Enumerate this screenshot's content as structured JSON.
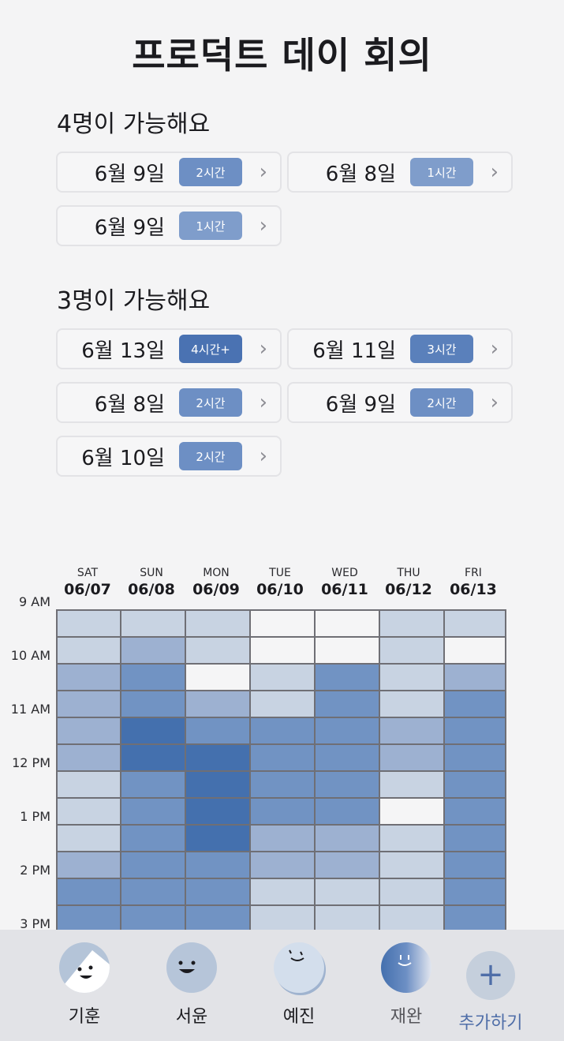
{
  "title": "프로덕트 데이 회의",
  "groups": [
    {
      "heading": "4명이 가능해요",
      "slots": [
        {
          "date": "6월 9일",
          "badge": "2시간",
          "color": "#6d8fc4"
        },
        {
          "date": "6월 8일",
          "badge": "1시간",
          "color": "#7f9dcb"
        },
        {
          "date": "6월 9일",
          "badge": "1시간",
          "color": "#7f9dcb"
        }
      ]
    },
    {
      "heading": "3명이 가능해요",
      "slots": [
        {
          "date": "6월 13일",
          "badge": "4시간+",
          "color": "#4a72b2"
        },
        {
          "date": "6월 11일",
          "badge": "3시간",
          "color": "#5a80bb"
        },
        {
          "date": "6월 8일",
          "badge": "2시간",
          "color": "#6d8fc4"
        },
        {
          "date": "6월 9일",
          "badge": "2시간",
          "color": "#6d8fc4"
        },
        {
          "date": "6월 10일",
          "badge": "2시간",
          "color": "#6d8fc4"
        }
      ]
    }
  ],
  "chevron": "›",
  "days": [
    {
      "dow": "SAT",
      "md": "06/07"
    },
    {
      "dow": "SUN",
      "md": "06/08"
    },
    {
      "dow": "MON",
      "md": "06/09"
    },
    {
      "dow": "TUE",
      "md": "06/10"
    },
    {
      "dow": "WED",
      "md": "06/11"
    },
    {
      "dow": "THU",
      "md": "06/12"
    },
    {
      "dow": "FRI",
      "md": "06/13"
    }
  ],
  "times": [
    "9 AM",
    "10 AM",
    "11 AM",
    "12 PM",
    "1 PM",
    "2 PM",
    "3 PM"
  ],
  "heat_palette": [
    "#f5f5f6",
    "#c8d3e2",
    "#9db1d1",
    "#7193c3",
    "#4470ae"
  ],
  "heatmap": [
    [
      1,
      1,
      1,
      0,
      0,
      1,
      1
    ],
    [
      1,
      2,
      1,
      0,
      0,
      1,
      0
    ],
    [
      2,
      3,
      0,
      1,
      3,
      1,
      2
    ],
    [
      2,
      3,
      2,
      1,
      3,
      1,
      3
    ],
    [
      2,
      4,
      3,
      3,
      3,
      2,
      3
    ],
    [
      2,
      4,
      4,
      3,
      3,
      2,
      3
    ],
    [
      1,
      3,
      4,
      3,
      3,
      1,
      3
    ],
    [
      1,
      3,
      4,
      3,
      3,
      0,
      3
    ],
    [
      1,
      3,
      4,
      2,
      2,
      1,
      3
    ],
    [
      2,
      3,
      3,
      2,
      2,
      1,
      3
    ],
    [
      3,
      3,
      3,
      1,
      1,
      1,
      3
    ],
    [
      3,
      3,
      3,
      1,
      1,
      1,
      3
    ]
  ],
  "people": [
    {
      "name": "기훈",
      "icon": "avatar-gihoon-icon"
    },
    {
      "name": "서윤",
      "icon": "avatar-seoyun-icon"
    },
    {
      "name": "예진",
      "icon": "avatar-yejin-icon"
    },
    {
      "name": "재완",
      "icon": "avatar-jaewan-icon"
    }
  ],
  "add": {
    "icon": "+",
    "label": "추가하기"
  }
}
